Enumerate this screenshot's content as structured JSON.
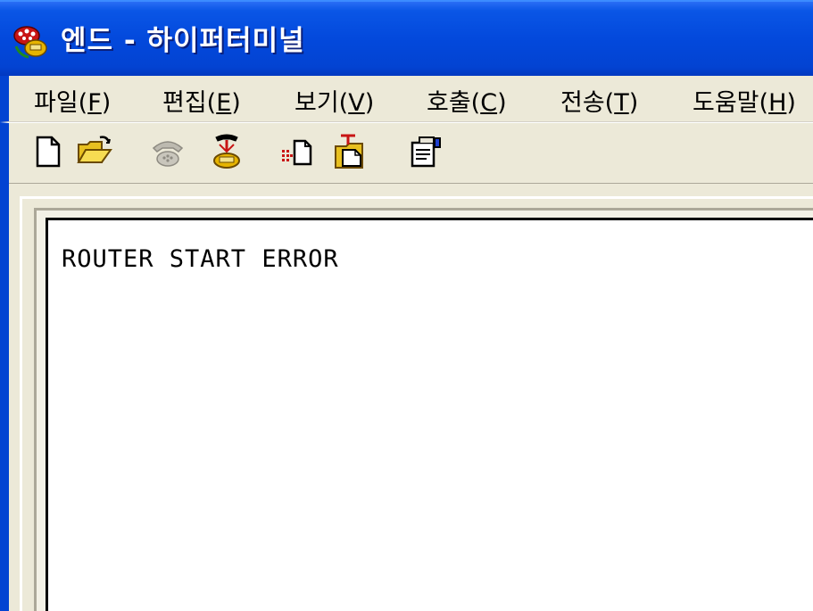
{
  "window": {
    "title": "엔드 - 하이퍼터미널"
  },
  "menu": {
    "items": [
      {
        "label": "파일(",
        "key": "F",
        "tail": ")"
      },
      {
        "label": "편집(",
        "key": "E",
        "tail": ")"
      },
      {
        "label": "보기(",
        "key": "V",
        "tail": ")"
      },
      {
        "label": "호출(",
        "key": "C",
        "tail": ")"
      },
      {
        "label": "전송(",
        "key": "T",
        "tail": ")"
      },
      {
        "label": "도움말(",
        "key": "H",
        "tail": ")"
      }
    ]
  },
  "toolbar": {
    "icons": [
      "new-document-icon",
      "open-folder-icon",
      "dial-phone-icon",
      "disconnect-phone-icon",
      "send-file-icon",
      "receive-file-icon",
      "properties-icon"
    ]
  },
  "terminal": {
    "lines": [
      "ROUTER START ERROR"
    ]
  },
  "colors": {
    "titlebar": "#0349dc",
    "chrome": "#ece9d8",
    "terminal_bg": "#ffffff"
  }
}
